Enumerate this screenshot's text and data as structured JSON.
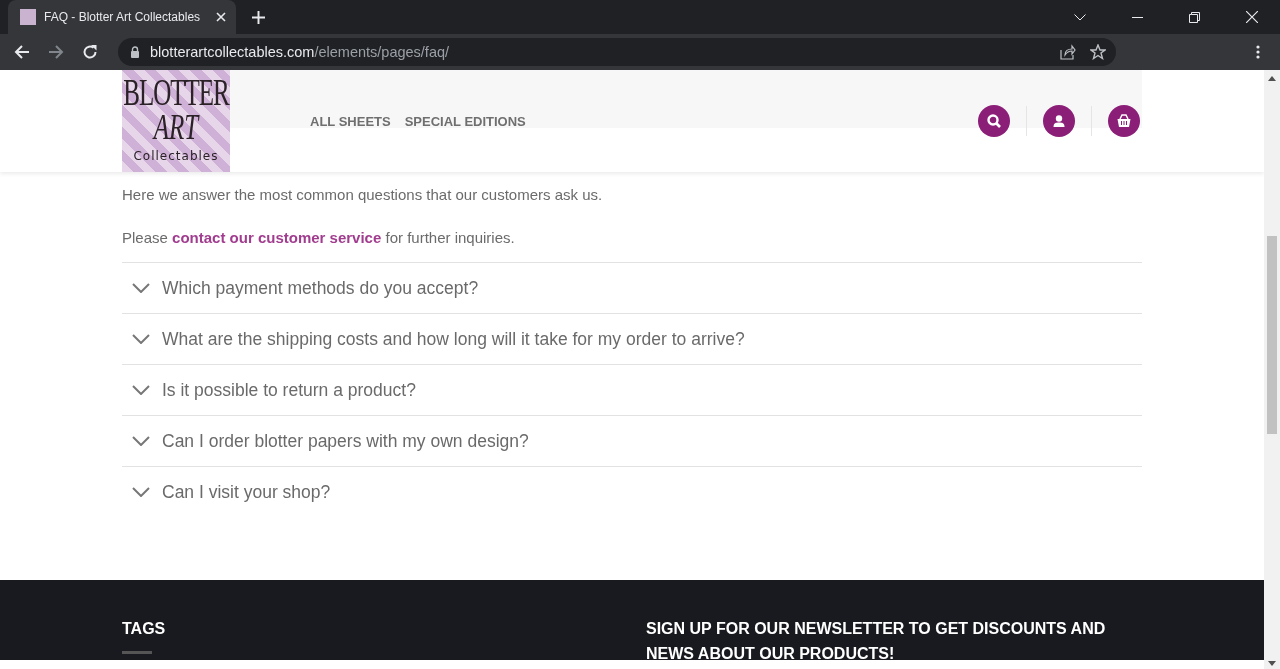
{
  "browser": {
    "tab": {
      "title": "FAQ - Blotter Art Collectables",
      "selected": true
    },
    "url_host": "blotterartcollectables.com",
    "url_path": "/elements/pages/faq/"
  },
  "header": {
    "logo": {
      "line_1": "BLOTTER",
      "line_2": "ART",
      "line_3": "Collectables"
    },
    "nav": [
      {
        "label": "ALL SHEETS"
      },
      {
        "label": "SPECIAL EDITIONS"
      }
    ],
    "actions": [
      {
        "kind": "search"
      },
      {
        "kind": "account"
      },
      {
        "kind": "basket"
      }
    ]
  },
  "intro": "Here we answer the most common questions that our customers ask us.",
  "contact": {
    "before": "Please ",
    "link": "contact our customer service",
    "after": " for further inquiries."
  },
  "faq": [
    {
      "question": "Which payment methods do you accept?",
      "expanded": false
    },
    {
      "question": "What are the shipping costs and how long will it take for my order to arrive?",
      "expanded": false
    },
    {
      "question": "Is it possible to return a product?",
      "expanded": false
    },
    {
      "question": "Can I order blotter papers with my own design?",
      "expanded": false
    },
    {
      "question": "Can I visit your shop?",
      "expanded": false
    }
  ],
  "footer": {
    "tags_title": "TAGS",
    "newsletter_title": "SIGN UP FOR OUR NEWSLETTER TO GET DISCOUNTS AND NEWS ABOUT OUR PRODUCTS!"
  }
}
